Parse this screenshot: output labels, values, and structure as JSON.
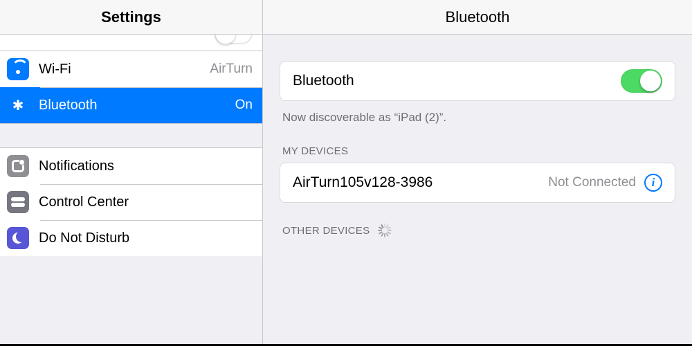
{
  "sidebar": {
    "title": "Settings",
    "items": {
      "wifi": {
        "label": "Wi-Fi",
        "status": "AirTurn"
      },
      "bluetooth": {
        "label": "Bluetooth",
        "status": "On"
      },
      "notifications": {
        "label": "Notifications"
      },
      "controlcenter": {
        "label": "Control Center"
      },
      "dnd": {
        "label": "Do Not Disturb"
      }
    }
  },
  "detail": {
    "title": "Bluetooth",
    "toggle_label": "Bluetooth",
    "toggle_on": true,
    "discoverable_text": "Now discoverable as “iPad (2)”.",
    "my_devices_label": "MY DEVICES",
    "devices": [
      {
        "name": "AirTurn105v128-3986",
        "status": "Not Connected"
      }
    ],
    "other_devices_label": "OTHER DEVICES"
  }
}
